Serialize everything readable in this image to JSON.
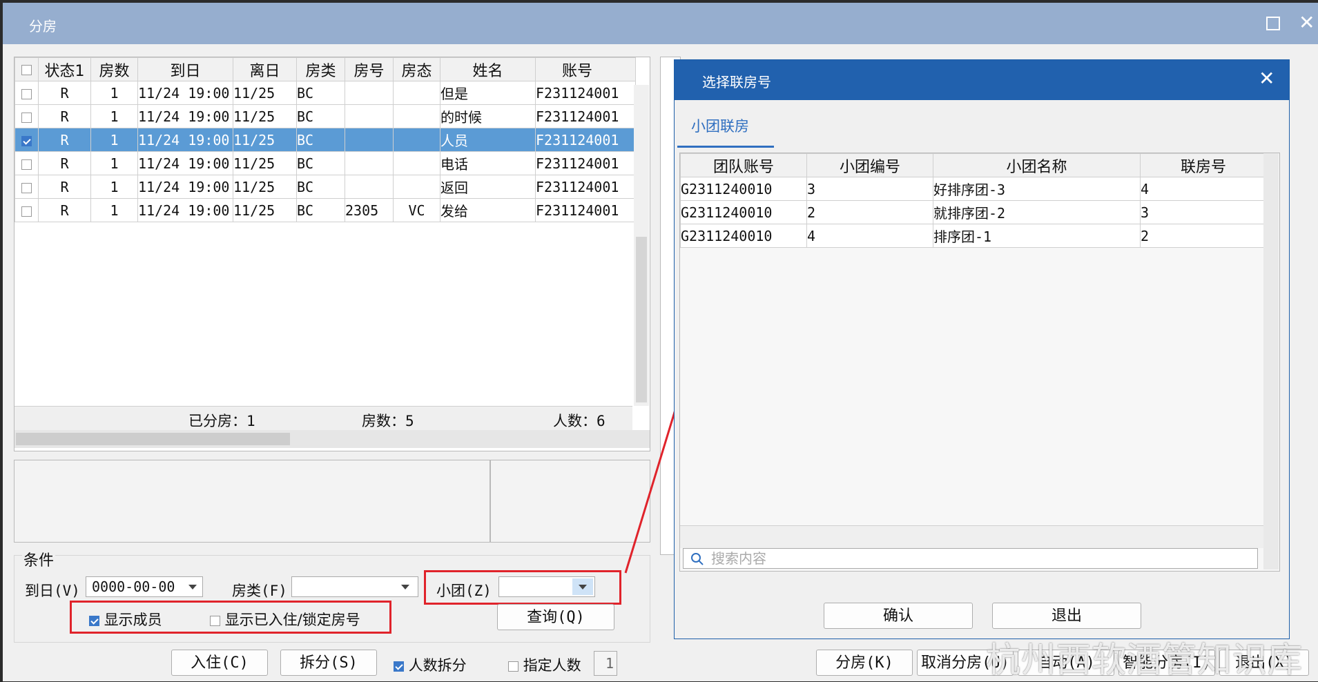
{
  "window": {
    "title": "分房"
  },
  "grid": {
    "headers": [
      "状态1",
      "房数",
      "到日",
      "离日",
      "房类",
      "房号",
      "房态",
      "姓名",
      "账号"
    ],
    "rows": [
      {
        "status": "R",
        "rooms": "1",
        "arrive": "11/24 19:00",
        "depart": "11/25",
        "type": "BC",
        "room": "",
        "state": "",
        "name": "但是",
        "account": "F231124001",
        "checked": false,
        "selected": false
      },
      {
        "status": "R",
        "rooms": "1",
        "arrive": "11/24 19:00",
        "depart": "11/25",
        "type": "BC",
        "room": "",
        "state": "",
        "name": "的时候",
        "account": "F231124001",
        "checked": false,
        "selected": false
      },
      {
        "status": "R",
        "rooms": "1",
        "arrive": "11/24 19:00",
        "depart": "11/25",
        "type": "BC",
        "room": "",
        "state": "",
        "name": "人员",
        "account": "F231124001",
        "checked": true,
        "selected": true
      },
      {
        "status": "R",
        "rooms": "1",
        "arrive": "11/24 19:00",
        "depart": "11/25",
        "type": "BC",
        "room": "",
        "state": "",
        "name": "电话",
        "account": "F231124001",
        "checked": false,
        "selected": false
      },
      {
        "status": "R",
        "rooms": "1",
        "arrive": "11/24 19:00",
        "depart": "11/25",
        "type": "BC",
        "room": "",
        "state": "",
        "name": "返回",
        "account": "F231124001",
        "checked": false,
        "selected": false
      },
      {
        "status": "R",
        "rooms": "1",
        "arrive": "11/24 19:00",
        "depart": "11/25",
        "type": "BC",
        "room": "2305",
        "state": "VC",
        "name": "发给",
        "account": "F231124001",
        "checked": false,
        "selected": false
      }
    ],
    "footer": {
      "assigned": "已分房：1",
      "rooms": "房数：5",
      "people": "人数：6"
    }
  },
  "conditions": {
    "title": "条件",
    "arrive_label": "到日(V)",
    "arrive_value": "0000-00-00",
    "type_label": "房类(F)",
    "group_label": "小团(Z)",
    "show_members": "显示成员",
    "show_checkedin": "显示已入住/锁定房号",
    "query_button": "查询(Q)"
  },
  "bottom": {
    "checkin": "入住(C)",
    "split": "拆分(S)",
    "split_by_people": "人数拆分",
    "specify_people": "指定人数",
    "people_value": "1",
    "assign": "分房(K)",
    "cancel_assign": "取消分房(U)",
    "auto": "自动(A)",
    "smart": "智能分房(I)",
    "exit": "退出(X)"
  },
  "dialog": {
    "title": "选择联房号",
    "tab": "小团联房",
    "headers": [
      "团队账号",
      "小团编号",
      "小团名称",
      "联房号"
    ],
    "rows": [
      {
        "account": "G2311240010",
        "no": "3",
        "name": "好排序团-3",
        "link": "4"
      },
      {
        "account": "G2311240010",
        "no": "2",
        "name": "就排序团-2",
        "link": "3"
      },
      {
        "account": "G2311240010",
        "no": "4",
        "name": "排序团-1",
        "link": "2"
      }
    ],
    "search_placeholder": "搜索内容",
    "confirm": "确认",
    "exit": "退出"
  },
  "watermark": "杭州西软酒管知识库",
  "colors": {
    "accent": "#2161ae",
    "selection": "#5b9bd5",
    "highlight": "#e0232b"
  }
}
